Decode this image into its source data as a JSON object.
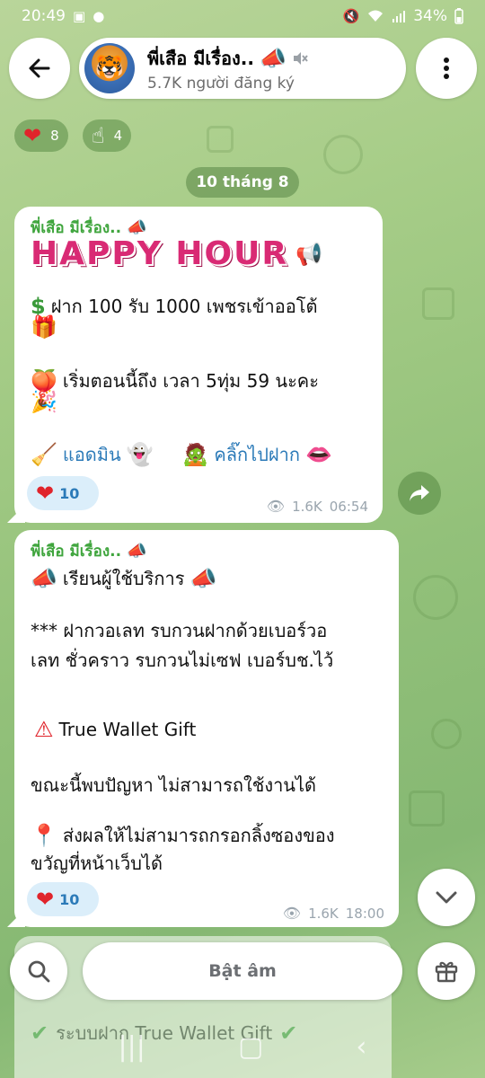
{
  "status_bar": {
    "time": "20:49",
    "battery": "34%",
    "left_icons": [
      "gallery-icon",
      "chat-icon"
    ],
    "right_icons": [
      "mute-icon",
      "wifi-icon",
      "signal-icon",
      "battery-icon"
    ]
  },
  "header": {
    "channel_name": "พี่เสือ มีเรื่อง..",
    "subscribers": "5.7K người đăng ký",
    "muted_icon": "speaker-muted-icon"
  },
  "top_reactions": [
    {
      "icon": "heart-icon",
      "count": "8"
    },
    {
      "icon": "raised-finger-icon",
      "count": "4"
    }
  ],
  "date_label": "10 tháng 8",
  "messages": [
    {
      "sender": "พี่เสือ มีเรื่อง..",
      "banner": "HAPPY HOUR",
      "line1": "ฝาก 100 รับ 1000 เพชรเข้าออโต้",
      "line2": "เริ่มตอนนี้ถึง เวลา 5ทุ่ม 59 นะคะ",
      "link_admin": "แอดมิน",
      "link_deposit": "คลิ๊กไปฝาก",
      "reaction_count": "10",
      "views": "1.6K",
      "time": "06:54"
    },
    {
      "sender": "พี่เสือ มีเรื่อง..",
      "line1": "เรียนผู้ใช้บริการ",
      "line2a": "*** ฝากวอเลท รบกวนฝากด้วยเบอร์วอ",
      "line2b": "เลท ชั่วคราว รบกวนไม่เซฟ เบอร์บช.ไว้",
      "line3": "True Wallet Gift",
      "line4": "ขณะนี้พบปัญหา ไม่สามารถใช้งานได้",
      "line5a": "ส่งผลให้ไม่สามารถกรอกลิ้งซองของ",
      "line5b": "ขวัญที่หน้าเว็บได้",
      "reaction_count": "10",
      "views": "1.6K",
      "time": "18:00"
    }
  ],
  "partial_message": {
    "text": "ระบบฝาก True Wallet Gift"
  },
  "bottom_bar": {
    "unmute_label": "Bật âm"
  }
}
